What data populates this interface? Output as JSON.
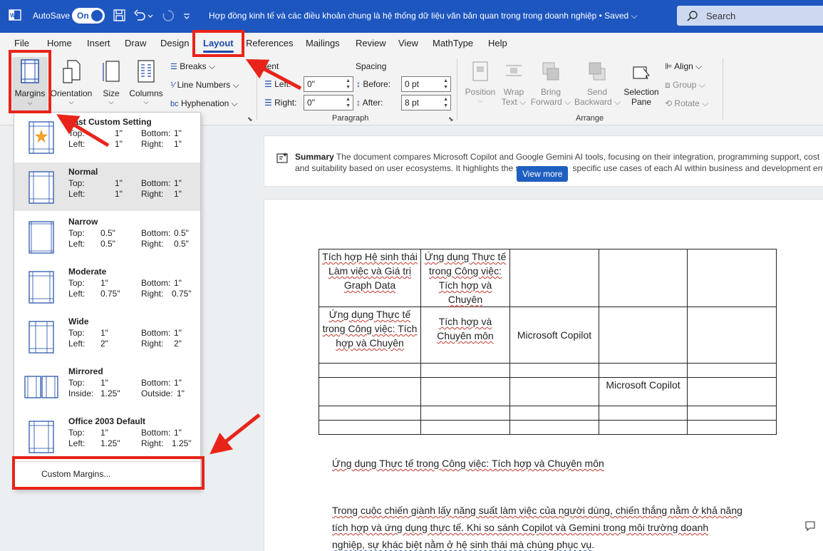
{
  "titlebar": {
    "autosave_label": "AutoSave",
    "toggle_label": "On",
    "doc_title": "Hợp đồng kinh tế và các điều khoản chung là hệ thống dữ liệu văn bản quan trọng trong doanh nghiệp • Saved ⌵",
    "search_placeholder": "Search"
  },
  "menu": {
    "tabs": [
      "File",
      "Home",
      "Insert",
      "Draw",
      "Design",
      "Layout",
      "References",
      "Mailings",
      "Review",
      "View",
      "MathType",
      "Help"
    ],
    "active": "Layout"
  },
  "ribbon": {
    "margins": "Margins",
    "orientation": "Orientation",
    "size": "Size",
    "columns": "Columns",
    "breaks": "Breaks ⌵",
    "line_numbers": "Line Numbers ⌵",
    "hyphenation": "Hyphenation ⌵",
    "indent_label": "dent",
    "spacing_label": "Spacing",
    "left_label": "Left:",
    "right_label": "Right:",
    "before_label": "Before:",
    "after_label": "After:",
    "left_value": "0\"",
    "right_value": "0\"",
    "before_value": "0 pt",
    "after_value": "8 pt",
    "paragraph_group": "Paragraph",
    "position": "Position",
    "wrap_text_1": "Wrap",
    "wrap_text_2": "Text ⌵",
    "bring_forward_1": "Bring",
    "bring_forward_2": "Forward ⌵",
    "send_backward_1": "Send",
    "send_backward_2": "Backward ⌵",
    "selection_pane_1": "Selection",
    "selection_pane_2": "Pane",
    "align": "Align ⌵",
    "group": "Group ⌵",
    "rotate": "Rotate ⌵",
    "arrange_group": "Arrange"
  },
  "summary": {
    "label": "Summary",
    "line1": "The document compares Microsoft Copilot and Google Gemini AI tools, focusing on their integration, programming support, cost",
    "line2": "and suitability based on user ecosystems. It highlights the s",
    "line2_tail": "specific use cases of each AI within business and development envir",
    "view_more": "View more"
  },
  "table": {
    "r1c1": "Tích hợp Hệ sinh thái Làm việc và Giá trị Graph Data",
    "r1c2": "Ứng dụng Thực tế trong Công việc: Tích hợp và Chuyên",
    "r2c1": "Ứng dụng Thực tế trong Công việc: Tích hợp và Chuyên",
    "r2c2": "Tích hợp và Chuyên môn",
    "r2c3": "Microsoft Copilot",
    "r4c4": "Microsoft Copilot"
  },
  "body": {
    "heading": "Ứng dụng Thực tế trong Công việc: Tích hợp và Chuyên môn",
    "p1": "Trong cuộc chiến giành lấy năng suất làm việc của người dùng, chiến thắng nằm ở khả năng",
    "p2": "tích hợp và ứng dụng thực tế. Khi so sánh Copilot và Gemini trong môi trường doanh",
    "p3": "nghiệp, sự khác biệt nằm ở hệ sinh thái mà chúng phục vụ."
  },
  "margins_menu": {
    "options": [
      {
        "name": "Last Custom Setting",
        "k1": "Top:",
        "v1": "1\"",
        "k2": "Bottom:",
        "v2": "1\"",
        "k3": "Left:",
        "v3": "1\"",
        "k4": "Right:",
        "v4": "1\""
      },
      {
        "name": "Normal",
        "k1": "Top:",
        "v1": "1\"",
        "k2": "Bottom:",
        "v2": "1\"",
        "k3": "Left:",
        "v3": "1\"",
        "k4": "Right:",
        "v4": "1\""
      },
      {
        "name": "Narrow",
        "k1": "Top:",
        "v1": "0.5\"",
        "k2": "Bottom:",
        "v2": "0.5\"",
        "k3": "Left:",
        "v3": "0.5\"",
        "k4": "Right:",
        "v4": "0.5\""
      },
      {
        "name": "Moderate",
        "k1": "Top:",
        "v1": "1\"",
        "k2": "Bottom:",
        "v2": "1\"",
        "k3": "Left:",
        "v3": "0.75\"",
        "k4": "Right:",
        "v4": "0.75\""
      },
      {
        "name": "Wide",
        "k1": "Top:",
        "v1": "1\"",
        "k2": "Bottom:",
        "v2": "1\"",
        "k3": "Left:",
        "v3": "2\"",
        "k4": "Right:",
        "v4": "2\""
      },
      {
        "name": "Mirrored",
        "k1": "Top:",
        "v1": "1\"",
        "k2": "Bottom:",
        "v2": "1\"",
        "k3": "Inside:",
        "v3": "1.25\"",
        "k4": "Outside:",
        "v4": "1\""
      },
      {
        "name": "Office 2003 Default",
        "k1": "Top:",
        "v1": "1\"",
        "k2": "Bottom:",
        "v2": "1\"",
        "k3": "Left:",
        "v3": "1.25\"",
        "k4": "Right:",
        "v4": "1.25\""
      }
    ],
    "custom_margins": "Custom Margins..."
  },
  "colors": {
    "title_bar": "#1e56c0",
    "accent": "#1b4aa8",
    "annotation_red": "#e8241a"
  }
}
